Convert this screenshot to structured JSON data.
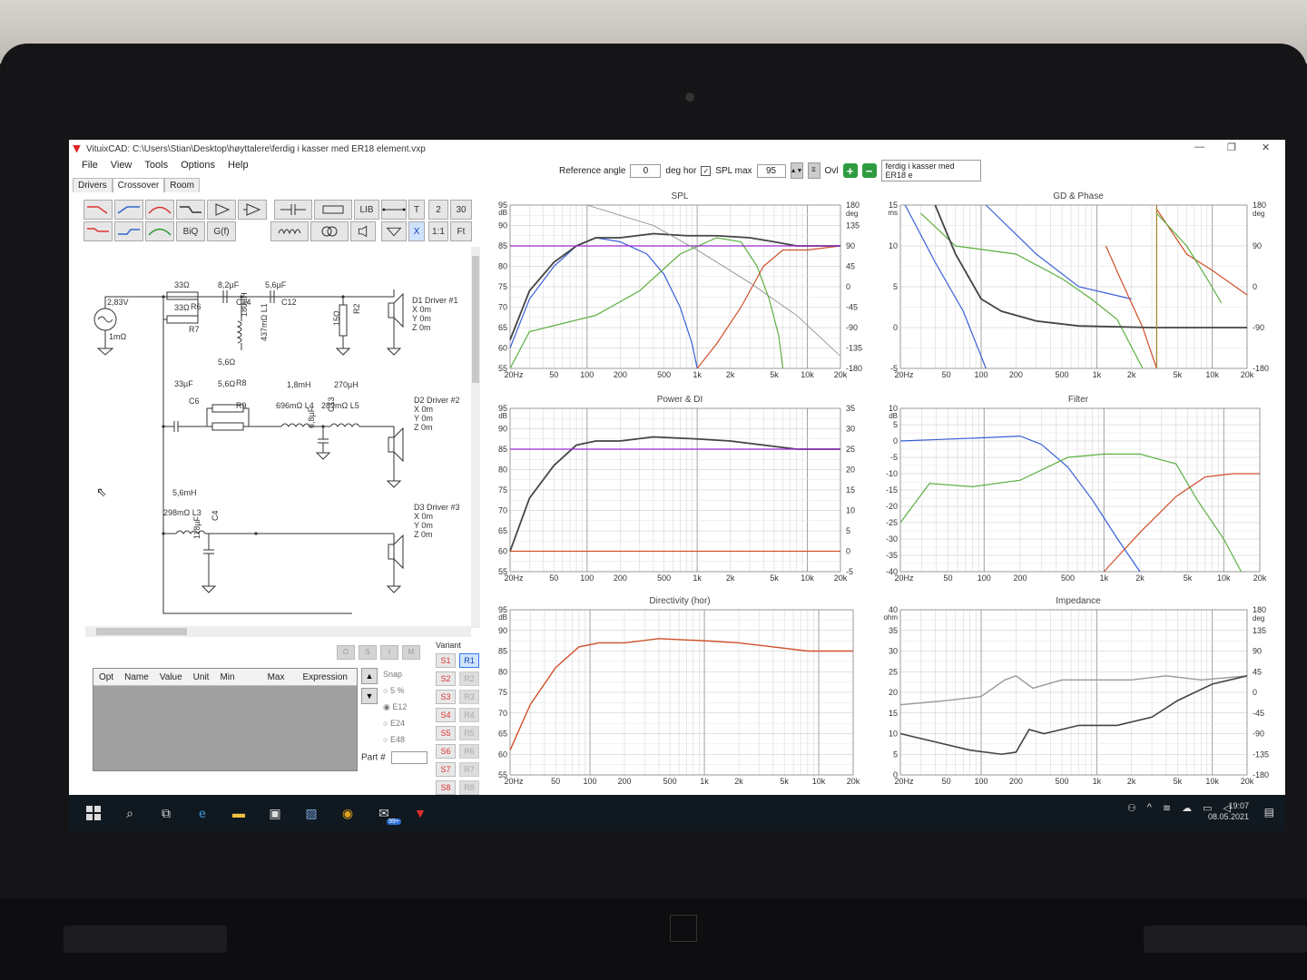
{
  "window": {
    "title": "VituixCAD: C:\\Users\\Stian\\Desktop\\høyttalere\\ferdig i kasser med ER18 element.vxp",
    "controls": [
      "—",
      "❐",
      "✕"
    ]
  },
  "menu": [
    "File",
    "View",
    "Tools",
    "Options",
    "Help"
  ],
  "tabs": [
    "Drivers",
    "Crossover",
    "Room"
  ],
  "toolbar": {
    "ref_angle_label": "Reference angle",
    "ref_angle_value": "0",
    "deg_hor": "deg hor",
    "spl_max_label": "SPL max",
    "spl_max_value": "95",
    "ovl_label": "Ovl",
    "overlay_name": "ferdig i kasser med ER18 e"
  },
  "palette": {
    "row1_text": [
      "LIB",
      "T",
      "2",
      "30"
    ],
    "row2_text": [
      "BiQ",
      "G(f)",
      "X",
      "1:1",
      "Ft"
    ]
  },
  "schematic": {
    "labels": [
      "2,83V",
      "1mΩ",
      "33Ω",
      "R6",
      "33Ω",
      "R7",
      "8,2µF",
      "C14",
      "5,6µF",
      "C12",
      "180µH",
      "437mΩ L1",
      "15Ω",
      "R2",
      "D1 Driver #1",
      "X 0m",
      "Y 0m",
      "Z 0m",
      "5,6Ω",
      "R8",
      "5,6Ω",
      "R9",
      "33µF",
      "C6",
      "1,8mH",
      "696mΩ L4",
      "270µH",
      "289mΩ L5",
      "6,8µF",
      "C13",
      "D2 Driver #2",
      "X 0m",
      "Y 0m",
      "Z 0m",
      "5,6mH",
      "298mΩ L3",
      "118µF",
      "C4",
      "D3 Driver #3",
      "X 0m",
      "Y 0m",
      "Z 0m"
    ]
  },
  "param_table": {
    "headers": [
      "Opt",
      "Name",
      "Value",
      "Unit",
      "Min",
      "Max",
      "Expression"
    ]
  },
  "snap": {
    "label": "Snap",
    "options": [
      "5 %",
      "E12",
      "E24",
      "E48"
    ],
    "selected": "E12"
  },
  "part_label": "Part #",
  "mode_buttons": [
    "O",
    "S",
    "I",
    "M"
  ],
  "variant": {
    "label": "Variant",
    "s": [
      "S1",
      "S2",
      "S3",
      "S4",
      "S5",
      "S6",
      "S7",
      "S8"
    ],
    "r": [
      "R1",
      "R2",
      "R3",
      "R4",
      "R5",
      "R6",
      "R7",
      "R8"
    ],
    "active_r": "R1"
  },
  "freq_ticks": [
    "20Hz",
    "50",
    "100",
    "200",
    "500",
    "1k",
    "2k",
    "5k",
    "10k",
    "20k"
  ],
  "panels": {
    "spl": {
      "title": "SPL",
      "unit_left": "dB",
      "unit_right": "deg",
      "left_ticks": [
        "95",
        "90",
        "85",
        "80",
        "75",
        "70",
        "65",
        "60",
        "55"
      ],
      "right_ticks": [
        "180",
        "135",
        "90",
        "45",
        "0",
        "-45",
        "-90",
        "-135",
        "-180"
      ]
    },
    "gd": {
      "title": "GD & Phase",
      "unit_left": "ms",
      "unit_right": "deg",
      "left_ticks": [
        "15",
        "10",
        "5",
        "0",
        "-5"
      ],
      "right_ticks": [
        "180",
        "90",
        "0",
        "-90",
        "-180"
      ]
    },
    "power": {
      "title": "Power & DI",
      "unit_left": "dB",
      "left_ticks": [
        "95",
        "90",
        "85",
        "80",
        "75",
        "70",
        "65",
        "60",
        "55"
      ],
      "right_ticks": [
        "35",
        "30",
        "25",
        "20",
        "15",
        "10",
        "5",
        "0",
        "-5"
      ]
    },
    "filter": {
      "title": "Filter",
      "unit_left": "dB",
      "left_ticks": [
        "10",
        "5",
        "0",
        "-5",
        "-10",
        "-15",
        "-20",
        "-25",
        "-30",
        "-35",
        "-40"
      ]
    },
    "directivity": {
      "title": "Directivity (hor)",
      "unit_left": "dB",
      "left_ticks": [
        "95",
        "90",
        "85",
        "80",
        "75",
        "70",
        "65",
        "60",
        "55"
      ]
    },
    "impedance": {
      "title": "Impedance",
      "unit_left": "ohm",
      "unit_right": "deg",
      "left_ticks": [
        "40",
        "35",
        "30",
        "25",
        "20",
        "15",
        "10",
        "5",
        "0"
      ],
      "right_ticks": [
        "180",
        "135",
        "90",
        "45",
        "0",
        "-45",
        "-90",
        "-135",
        "-180"
      ]
    }
  },
  "taskbar": {
    "badge": "99+",
    "time": "19:07",
    "date": "08.05.2021"
  },
  "colors": {
    "blue": "#3a5fd8",
    "green": "#5cb040",
    "red": "#d0502a",
    "purple": "#9a2ad0",
    "dark": "#444444",
    "grid": "#c8c8c8"
  }
}
